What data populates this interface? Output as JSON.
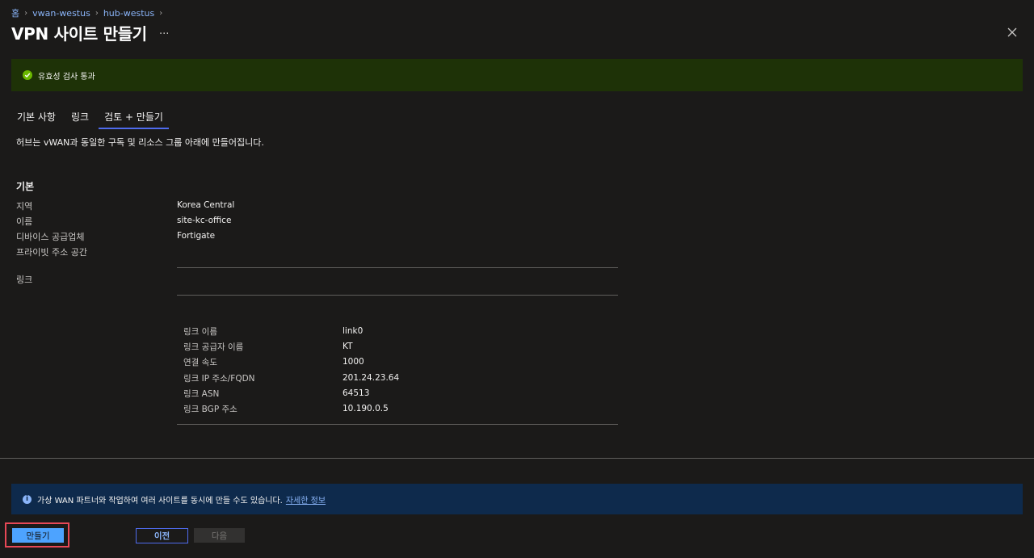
{
  "breadcrumb": [
    "홈",
    "vwan-westus",
    "hub-westus"
  ],
  "page_title": "VPN 사이트 만들기",
  "more_label": "...",
  "validation": {
    "text": "유효성 검사 통과"
  },
  "tabs": [
    {
      "label": "기본 사항"
    },
    {
      "label": "링크"
    },
    {
      "label": "검토 + 만들기"
    }
  ],
  "description": "허브는 vWAN과 동일한 구독 및 리소스 그룹 아래에 만들어집니다.",
  "basics": {
    "title": "기본",
    "region_label": "지역",
    "region_value": "Korea Central",
    "name_label": "이름",
    "name_value": "site-kc-office",
    "vendor_label": "디바이스 공급업체",
    "vendor_value": "Fortigate",
    "private_space_label": "프라이빗 주소 공간",
    "links_label": "링크"
  },
  "link": {
    "name_label": "링크 이름",
    "name_value": "link0",
    "provider_label": "링크 공급자 이름",
    "provider_value": "KT",
    "speed_label": "연결 속도",
    "speed_value": "1000",
    "ip_label": "링크 IP 주소/FQDN",
    "ip_value": "201.24.23.64",
    "asn_label": "링크 ASN",
    "asn_value": "64513",
    "bgp_label": "링크 BGP 주소",
    "bgp_value": "10.190.0.5"
  },
  "info": {
    "text": "가상 WAN 파트너와 작업하여 여러 사이트를 동시에 만들 수도 있습니다.",
    "link": "자세한 정보"
  },
  "buttons": {
    "create": "만들기",
    "previous": "이전",
    "next": "다음"
  },
  "colors": {
    "background": "#1b1a19",
    "success_banner": "#1e3207",
    "info_banner": "#0e2a4c",
    "accent": "#4da3ff",
    "highlight": "#e74856"
  }
}
